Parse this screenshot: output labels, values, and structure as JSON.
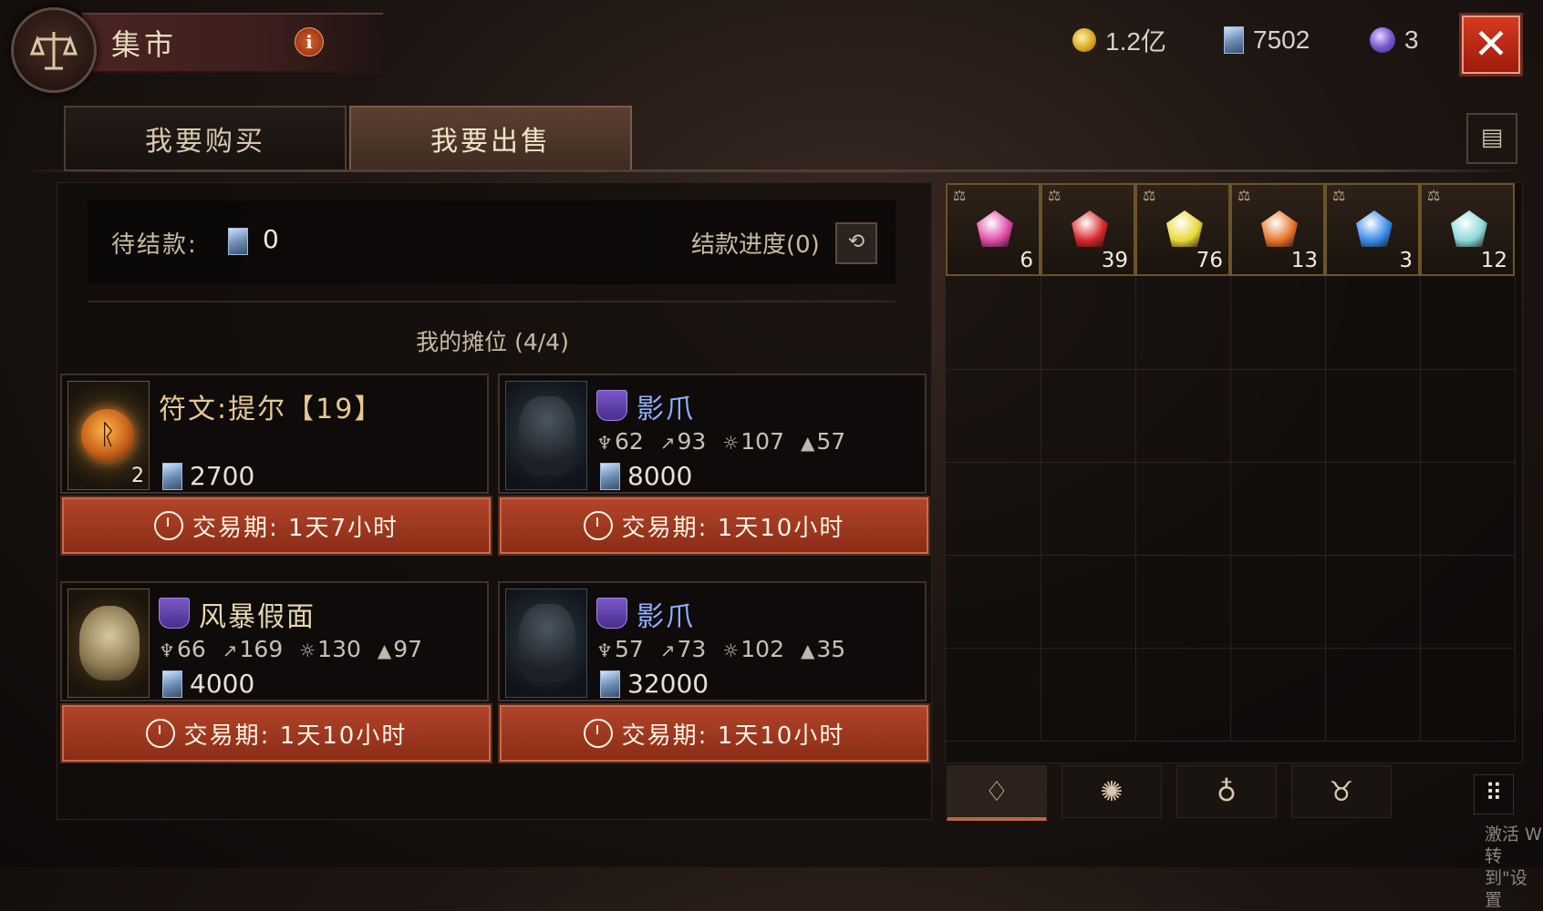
{
  "header": {
    "title": "集市",
    "info_label": "i"
  },
  "currencies": [
    {
      "icon": "gold-coin-icon",
      "value": "1.2亿"
    },
    {
      "icon": "crystal-icon",
      "value": "7502"
    },
    {
      "icon": "orb-icon",
      "value": "3"
    }
  ],
  "close_label": "✕",
  "tabs": {
    "buy": "我要购买",
    "sell": "我要出售"
  },
  "pending": {
    "label": "待结款:",
    "value": "0",
    "progress": "结款进度(0)"
  },
  "stalls_title": "我的摊位 (4/4)",
  "listings": [
    {
      "name": "符文:提尔【19】",
      "qty": "2",
      "price": "2700",
      "timer": "交易期: 1天7小时",
      "stats": []
    },
    {
      "name": "影爪",
      "price": "8000",
      "timer": "交易期: 1天10小时",
      "stats": [
        "62",
        "93",
        "107",
        "57"
      ]
    },
    {
      "name": "风暴假面",
      "price": "4000",
      "timer": "交易期: 1天10小时",
      "stats": [
        "66",
        "169",
        "130",
        "97"
      ]
    },
    {
      "name": "影爪",
      "price": "32000",
      "timer": "交易期: 1天10小时",
      "stats": [
        "57",
        "73",
        "102",
        "35"
      ]
    }
  ],
  "inventory": [
    {
      "gem": "pink",
      "color": "#e04aa8",
      "count": "6"
    },
    {
      "gem": "red",
      "color": "#d8262a",
      "count": "39"
    },
    {
      "gem": "yellow",
      "color": "#e8d838",
      "count": "76"
    },
    {
      "gem": "orange",
      "color": "#e8742a",
      "count": "13"
    },
    {
      "gem": "blue",
      "color": "#3a8ae8",
      "count": "3"
    },
    {
      "gem": "cyan",
      "color": "#8ad8d8",
      "count": "12"
    }
  ],
  "watermark": [
    "激活 W",
    "转到\"设置"
  ]
}
